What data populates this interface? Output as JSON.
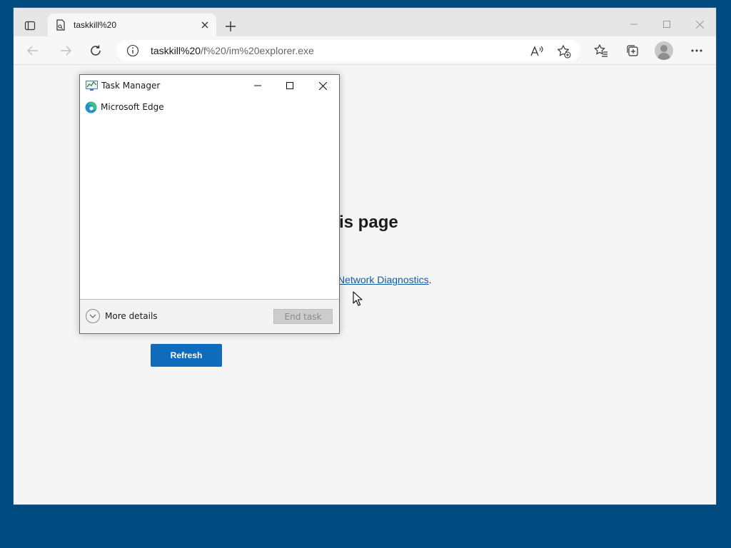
{
  "browser": {
    "tab": {
      "title": "taskkill%20"
    },
    "address": {
      "url_host": "taskkill%20",
      "url_path": "/f%20/im%20explorer.exe"
    },
    "icons": {
      "tab_actions": "tab-actions-icon",
      "favicon": "file-icon",
      "tab_close": "close-icon",
      "new_tab": "plus-icon",
      "minimize": "minimize-icon",
      "maximize": "maximize-icon",
      "close": "close-icon",
      "back": "back-arrow-icon",
      "forward": "forward-arrow-icon",
      "refresh": "refresh-icon",
      "site_info": "info-icon",
      "read_aloud": "read-aloud-icon",
      "add_favorite": "add-favorite-icon",
      "favorites": "favorites-icon",
      "collections": "collections-icon",
      "profile": "profile-icon",
      "more": "more-icon"
    }
  },
  "page": {
    "heading": "is page",
    "link_text": "Network Diagnostics",
    "link_suffix": ".",
    "refresh_label": "Refresh"
  },
  "task_manager": {
    "title": "Task Manager",
    "processes": [
      {
        "name": "Microsoft Edge"
      }
    ],
    "more_details_label": "More details",
    "end_task_label": "End task"
  },
  "colors": {
    "desktop": "#004a80",
    "accent": "#0f6cbd",
    "link": "#0f5aa3",
    "page_bg": "#f5f5f5"
  }
}
